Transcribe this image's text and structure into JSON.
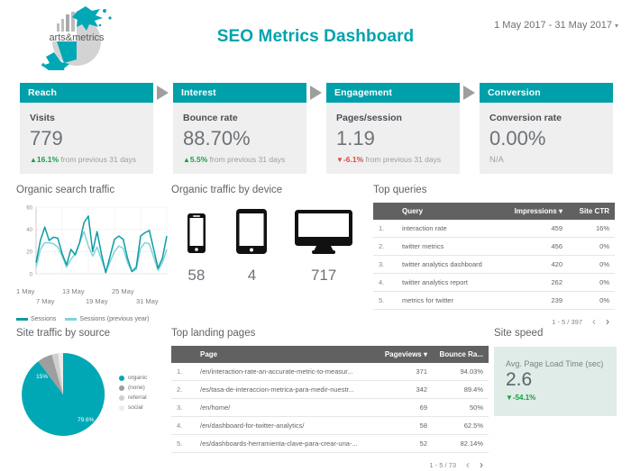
{
  "header": {
    "title": "SEO Metrics Dashboard",
    "date_range": "1 May 2017 - 31 May 2017",
    "date_caret": "▾",
    "logo_text": "arts&metrics"
  },
  "kpis": [
    {
      "stage": "Reach",
      "label": "Visits",
      "value": "779",
      "delta": "16.1%",
      "delta_dir": "up",
      "delta_suffix": "from previous 31 days",
      "arrow": "▲"
    },
    {
      "stage": "Interest",
      "label": "Bounce rate",
      "value": "88.70%",
      "delta": "5.5%",
      "delta_dir": "up",
      "delta_suffix": "from previous 31 days",
      "arrow": "▲"
    },
    {
      "stage": "Engagement",
      "label": "Pages/session",
      "value": "1.19",
      "delta": "-6.1%",
      "delta_dir": "down",
      "delta_suffix": "from previous 31 days",
      "arrow": "▼"
    },
    {
      "stage": "Conversion",
      "label": "Conversion rate",
      "value": "0.00%",
      "delta": "",
      "delta_dir": "na",
      "delta_suffix": "N/A",
      "arrow": ""
    }
  ],
  "panels": {
    "organic_search_traffic": "Organic search traffic",
    "organic_traffic_by_device": "Organic traffic by device",
    "top_queries": "Top queries",
    "site_traffic_by_source": "Site traffic by source",
    "top_landing_pages": "Top landing pages",
    "site_speed": "Site speed"
  },
  "devices": [
    {
      "icon": "mobile-phone-icon",
      "value": "58"
    },
    {
      "icon": "tablet-icon",
      "value": "4"
    },
    {
      "icon": "desktop-icon",
      "value": "717"
    }
  ],
  "queries_table": {
    "columns": [
      "",
      "Query",
      "Impressions",
      "Site CTR"
    ],
    "sort_indicator": "▾",
    "rows": [
      {
        "idx": "1.",
        "query": "interaction rate",
        "impressions": "459",
        "ctr": "16%"
      },
      {
        "idx": "2.",
        "query": "twitter metrics",
        "impressions": "456",
        "ctr": "0%"
      },
      {
        "idx": "3.",
        "query": "twitter analytics dashboard",
        "impressions": "420",
        "ctr": "0%"
      },
      {
        "idx": "4.",
        "query": "twitter analytics report",
        "impressions": "262",
        "ctr": "0%"
      },
      {
        "idx": "5.",
        "query": "metrics for twitter",
        "impressions": "239",
        "ctr": "0%"
      }
    ],
    "pager": "1 - 5 / 397",
    "prev": "‹",
    "next": "›"
  },
  "landing_table": {
    "columns": [
      "",
      "Page",
      "Pageviews",
      "Bounce Ra..."
    ],
    "sort_indicator": "▾",
    "rows": [
      {
        "idx": "1.",
        "page": "/en/interaction-rate-an-accurate-metric-to-measur...",
        "pageviews": "371",
        "bounce": "94.03%"
      },
      {
        "idx": "2.",
        "page": "/es/tasa-de-interaccion-metrica-para-medir-nuestr...",
        "pageviews": "342",
        "bounce": "89.4%"
      },
      {
        "idx": "3.",
        "page": "/en/home/",
        "pageviews": "69",
        "bounce": "50%"
      },
      {
        "idx": "4.",
        "page": "/en/dashboard-for-twitter-analytics/",
        "pageviews": "58",
        "bounce": "62.5%"
      },
      {
        "idx": "5.",
        "page": "/es/dashboards-herramienta-clave-para-crear-una-...",
        "pageviews": "52",
        "bounce": "82.14%"
      }
    ],
    "pager": "1 - 5 / 73",
    "prev": "‹",
    "next": "›"
  },
  "site_speed": {
    "label": "Avg. Page Load Time (sec)",
    "value": "2.6",
    "delta": "-54.1%",
    "arrow": "▼"
  },
  "colors": {
    "teal": "#00A0AB",
    "teal_dark": "#0E9BA6",
    "teal_light": "#7FD4D8",
    "header_gray": "#616161",
    "card_gray": "#efefef",
    "green": "#189e43",
    "red": "#e8453c",
    "speed_bg": "#dfece8"
  },
  "chart_data": [
    {
      "type": "line",
      "title": "Organic search traffic",
      "xlabel": "",
      "ylabel": "",
      "ylim": [
        0,
        60
      ],
      "yticks": [
        0,
        20,
        40,
        60
      ],
      "grid": true,
      "legend_position": "bottom",
      "x": [
        "1 May",
        "2 May",
        "3 May",
        "4 May",
        "5 May",
        "6 May",
        "7 May",
        "8 May",
        "9 May",
        "10 May",
        "11 May",
        "12 May",
        "13 May",
        "14 May",
        "15 May",
        "16 May",
        "17 May",
        "18 May",
        "19 May",
        "20 May",
        "21 May",
        "22 May",
        "23 May",
        "24 May",
        "25 May",
        "26 May",
        "27 May",
        "28 May",
        "29 May",
        "30 May",
        "31 May"
      ],
      "xtick_labels": [
        "1 May",
        "7 May",
        "13 May",
        "19 May",
        "25 May",
        "31 May"
      ],
      "series": [
        {
          "name": "Sessions",
          "color": "#0E9BA6",
          "values": [
            10,
            30,
            42,
            30,
            33,
            32,
            18,
            8,
            22,
            17,
            28,
            46,
            52,
            20,
            38,
            18,
            1,
            16,
            31,
            34,
            31,
            14,
            2,
            6,
            34,
            37,
            39,
            22,
            5,
            14,
            34
          ]
        },
        {
          "name": "Sessions (previous year)",
          "color": "#7FD4D8",
          "values": [
            6,
            22,
            28,
            28,
            27,
            24,
            16,
            6,
            13,
            18,
            28,
            38,
            25,
            16,
            24,
            13,
            2,
            11,
            20,
            25,
            23,
            10,
            2,
            4,
            23,
            28,
            27,
            15,
            3,
            10,
            22
          ]
        }
      ]
    },
    {
      "type": "pie",
      "title": "Site traffic by source",
      "labels": [
        "organic",
        "(none)",
        "referral",
        "social"
      ],
      "values": [
        79.6,
        15,
        3.4,
        2
      ],
      "display_labels": [
        "79.6%",
        "15%",
        "",
        ""
      ],
      "colors": [
        "#00A8B5",
        "#9e9e9e",
        "#cfcfcf",
        "#ececec"
      ],
      "legend_position": "right"
    },
    {
      "type": "bar",
      "title": "Organic traffic by device",
      "categories": [
        "mobile",
        "tablet",
        "desktop"
      ],
      "values": [
        58,
        4,
        717
      ],
      "xlabel": "",
      "ylabel": ""
    }
  ]
}
